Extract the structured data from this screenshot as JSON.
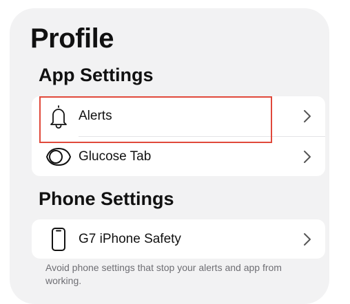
{
  "page": {
    "title": "Profile"
  },
  "sections": {
    "app_settings": {
      "title": "App Settings",
      "items": [
        {
          "label": "Alerts",
          "icon": "bell-icon"
        },
        {
          "label": "Glucose Tab",
          "icon": "eye-icon"
        }
      ]
    },
    "phone_settings": {
      "title": "Phone Settings",
      "items": [
        {
          "label": "G7 iPhone Safety",
          "icon": "phone-icon"
        }
      ],
      "note": "Avoid phone settings that stop your alerts and app from working."
    }
  },
  "colors": {
    "highlight": "#e0483a",
    "background": "#f2f2f3",
    "card": "#ffffff"
  }
}
